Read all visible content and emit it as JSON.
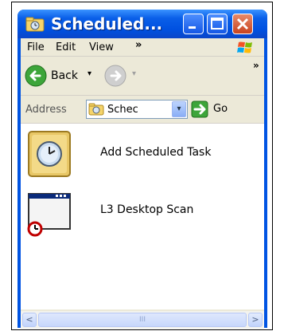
{
  "window": {
    "title": "Scheduled...",
    "controls": {
      "minimize": "minimize",
      "maximize": "maximize",
      "close": "close"
    }
  },
  "menu": {
    "items": [
      {
        "label": "File"
      },
      {
        "label": "Edit"
      },
      {
        "label": "View"
      }
    ],
    "overflow": "»"
  },
  "toolbar": {
    "back_label": "Back",
    "back_dropdown": "▾",
    "forward_dropdown": "▾",
    "overflow": "»"
  },
  "address": {
    "label": "Address",
    "value": "Schec",
    "dropdown": "▾",
    "go_label": "Go"
  },
  "content": {
    "items": [
      {
        "label": "Add Scheduled Task",
        "icon": "add-scheduled-task-icon"
      },
      {
        "label": "L3 Desktop Scan",
        "icon": "scheduled-task-icon"
      }
    ]
  },
  "scrollbar": {
    "left": "<",
    "right": ">",
    "thumb_grip": "III"
  },
  "colors": {
    "titlebar": "#0a5fe8",
    "client": "#ece9d8",
    "close_button": "#c8431f"
  }
}
